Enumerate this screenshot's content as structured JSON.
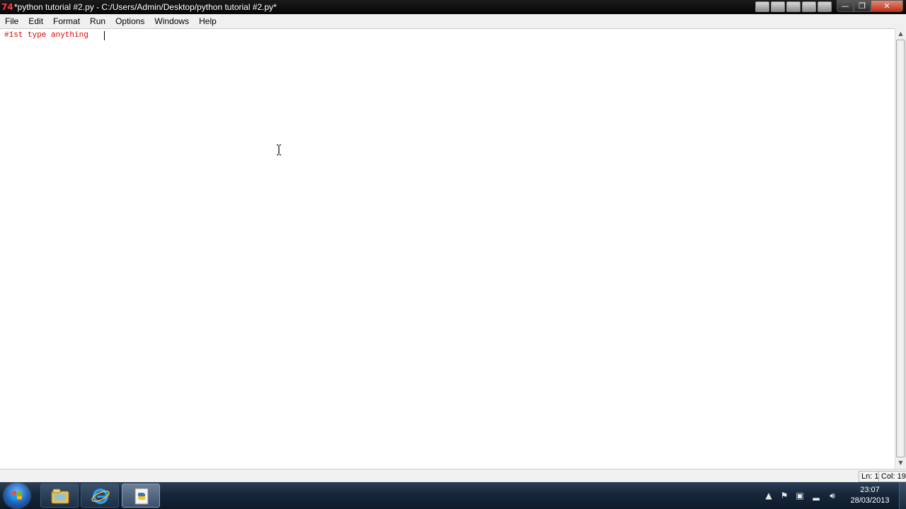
{
  "window": {
    "logo_text": "74",
    "title": "*python tutorial #2.py - C:/Users/Admin/Desktop/python tutorial #2.py*",
    "controls": {
      "minimize": "—",
      "maximize": "❐",
      "close": "✕"
    }
  },
  "menu": {
    "items": [
      "File",
      "Edit",
      "Format",
      "Run",
      "Options",
      "Windows",
      "Help"
    ]
  },
  "editor": {
    "lines": [
      "#1st type anything "
    ],
    "text_color": "#dd0000"
  },
  "status": {
    "line": "Ln: 1",
    "col": "Col: 19"
  },
  "taskbar": {
    "apps": [
      {
        "icon": "folder-icon",
        "active": false
      },
      {
        "icon": "internet-explorer-icon",
        "active": false
      },
      {
        "icon": "python-idle-icon",
        "active": true
      }
    ],
    "tray_icons": [
      "chevron-up-icon",
      "action-center-flag-icon",
      "usb-device-icon",
      "network-signal-icon",
      "volume-icon"
    ],
    "clock": {
      "time": "23:07",
      "date": "28/03/2013"
    }
  },
  "colors": {
    "titlebar": "#0a0a0a",
    "menubar": "#f0f0f0",
    "taskbar": "#16273b",
    "code_comment": "#dd0000"
  }
}
